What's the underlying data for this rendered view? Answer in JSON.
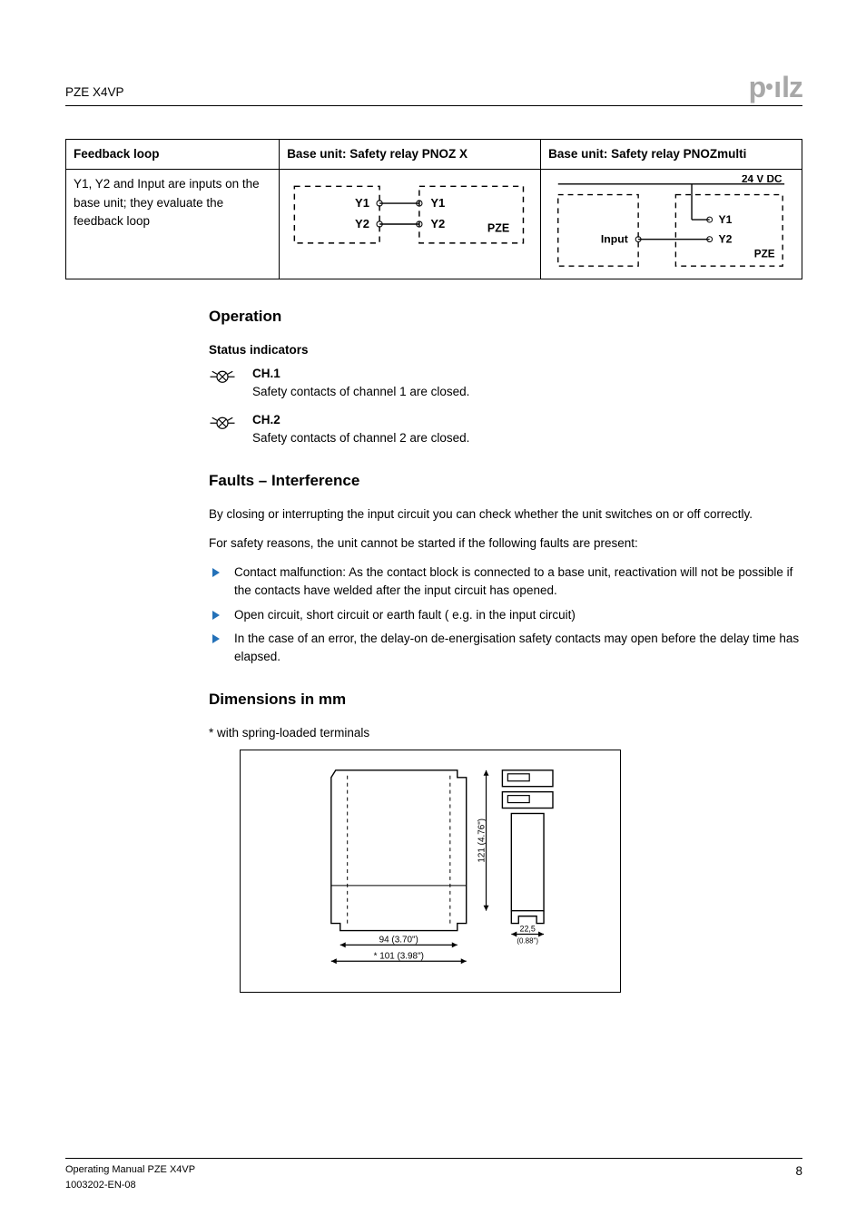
{
  "header": {
    "product": "PZE X4VP",
    "brand": "pilz"
  },
  "table": {
    "headers": {
      "a": "Feedback loop",
      "b": "Base unit: Safety relay PNOZ X",
      "c": "Base unit: Safety relay PNOZmulti"
    },
    "row": {
      "a": "Y1, Y2 and Input are inputs on the base unit; they evaluate the feedback loop",
      "diag_b": {
        "y1": "Y1",
        "y2": "Y2",
        "pze": "PZE"
      },
      "diag_c": {
        "vdc": "24 V DC",
        "input": "Input",
        "y1": "Y1",
        "y2": "Y2",
        "pze": "PZE"
      }
    }
  },
  "operation": {
    "title": "Operation",
    "status_title": "Status indicators",
    "ch1": {
      "title": "CH.1",
      "text": "Safety contacts of channel 1 are closed."
    },
    "ch2": {
      "title": "CH.2",
      "text": "Safety contacts of channel 2 are closed."
    }
  },
  "faults": {
    "title": "Faults – Interference",
    "p1": "By closing or interrupting the input circuit you can check whether the unit switches on or off correctly.",
    "p2": "For safety reasons, the unit cannot be started if the following faults are present:",
    "items": [
      "Contact malfunction: As the contact block is connected to a base unit, reactivation will not be possible if the contacts have welded after the input circuit has opened.",
      "Open circuit, short circuit or earth fault ( e.g. in the input circuit)",
      "In the case of an error, the delay-on de-energisation safety contacts may open before the delay time has elapsed."
    ]
  },
  "dimensions": {
    "title": "Dimensions in mm",
    "note": "* with spring-loaded terminals",
    "w1": "94 (3.70\")",
    "w2": "* 101 (3.98\")",
    "h": "121 (4.76\")",
    "d": "22,5",
    "d2": "(0.88\")"
  },
  "footer": {
    "left1": "Operating Manual PZE X4VP",
    "left2": "1003202-EN-08",
    "page": "8"
  }
}
